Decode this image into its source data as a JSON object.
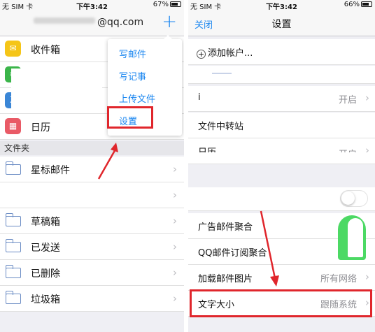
{
  "status_left": {
    "carrier": "无 SIM 卡",
    "time": "下午3:42",
    "battery": "67%"
  },
  "status_right": {
    "carrier": "无 SIM 卡",
    "time": "下午3:42",
    "battery": "66%"
  },
  "left": {
    "account": "@qq.com",
    "items": [
      {
        "label": "收件箱",
        "icon": "mail-icon",
        "color": "#f5c518"
      },
      {
        "label": "",
        "icon": "note-icon",
        "color": "#3bb54a"
      },
      {
        "label": "",
        "icon": "sort-icon",
        "color": "#3a86d6"
      },
      {
        "label": "日历",
        "icon": "calendar-icon",
        "color": "#e95a66"
      }
    ],
    "section_title": "文件夹",
    "folders": [
      "星标邮件",
      "",
      "草稿箱",
      "已发送",
      "已删除",
      "垃圾箱"
    ],
    "popup": [
      "写邮件",
      "写记事",
      "上传文件",
      "设置"
    ]
  },
  "right": {
    "close": "关闭",
    "title": "设置",
    "add_account": "添加帐户...",
    "rows": [
      {
        "label": "i",
        "value": "开启"
      },
      {
        "label": "文件中转站",
        "value": ""
      },
      {
        "label": "日历",
        "value": "开启"
      },
      {
        "label": "广告邮件聚合",
        "value": ""
      },
      {
        "label": "QQ邮件订阅聚合",
        "value": ""
      },
      {
        "label": "加载邮件图片",
        "value": "所有网络"
      },
      {
        "label": "文字大小",
        "value": "跟随系统"
      }
    ]
  },
  "colors": {
    "accent": "#1a86f0",
    "highlight": "#e0262c",
    "toggle_on": "#4cd964"
  }
}
